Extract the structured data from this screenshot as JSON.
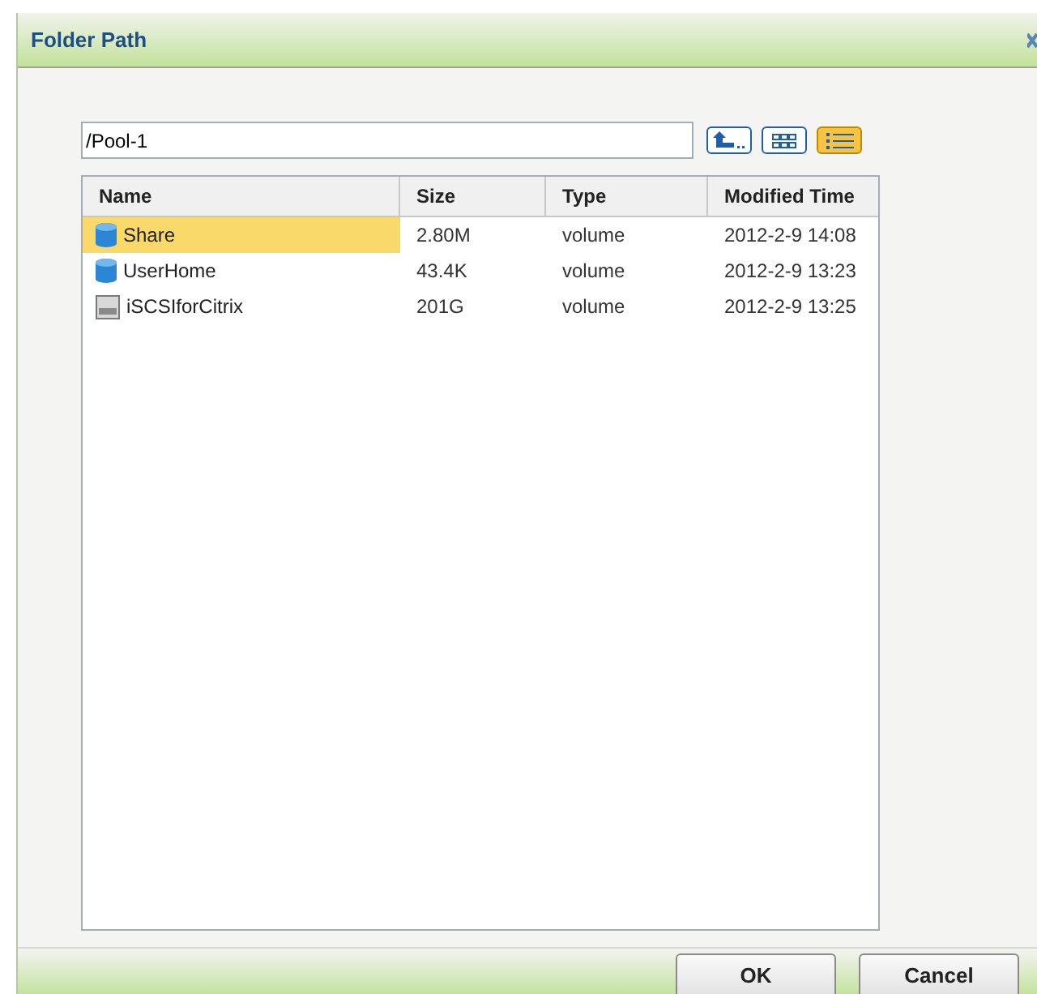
{
  "window": {
    "title": "Folder Path"
  },
  "path_field": {
    "value": "/Pool-1"
  },
  "toolbar": [
    {
      "kind": "up",
      "selected": false
    },
    {
      "kind": "thumbnails",
      "selected": false
    },
    {
      "kind": "list",
      "selected": true
    }
  ],
  "table": {
    "columns": [
      "Name",
      "Size",
      "Type",
      "Modified Time"
    ],
    "rows": [
      {
        "kind": "volume",
        "selected": true,
        "cells": [
          "Share",
          "2.80M",
          "volume",
          "2012-2-9 14:08"
        ]
      },
      {
        "kind": "volume",
        "selected": false,
        "cells": [
          "UserHome",
          "43.4K",
          "volume",
          "2012-2-9 13:23"
        ]
      },
      {
        "kind": "iscsi",
        "selected": false,
        "cells": [
          "iSCSIforCitrix",
          "201G",
          "volume",
          "2012-2-9 13:25"
        ]
      }
    ]
  },
  "buttons": [
    "OK",
    "Cancel"
  ]
}
